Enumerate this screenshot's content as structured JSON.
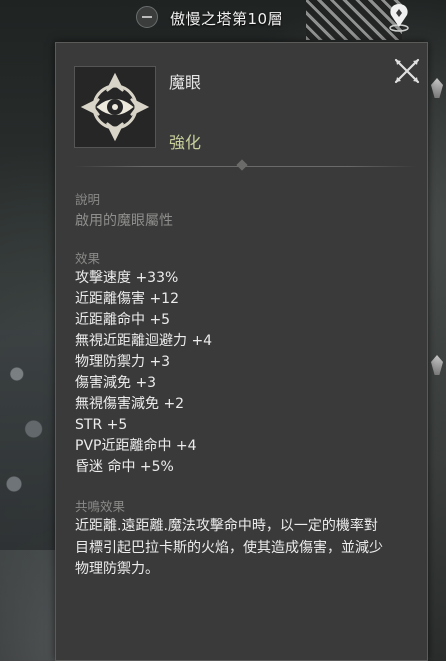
{
  "location": {
    "title": "傲慢之塔第10層"
  },
  "icons": {
    "collapse": "minus-circle-icon",
    "map_pin": "map-pin-icon",
    "item": "magic-eye-icon",
    "close": "close-x-icon"
  },
  "item": {
    "name": "魔眼",
    "grade": "強化"
  },
  "description": {
    "label": "說明",
    "text": "啟用的魔眼屬性"
  },
  "effects": {
    "label": "效果",
    "items": [
      "攻擊速度 +33%",
      "近距離傷害 +12",
      "近距離命中 +5",
      "無視近距離迴避力 +4",
      "物理防禦力 +3",
      "傷害減免 +3",
      "無視傷害減免 +2",
      "STR +5",
      "PVP近距離命中 +4",
      "昏迷 命中 +5%"
    ]
  },
  "resonance": {
    "label": "共鳴效果",
    "lines": [
      "近距離.遠距離.魔法攻擊命中時，以一定的機率對",
      "目標引起巴拉卡斯的火焰，使其造成傷害，並減少",
      "物理防禦力。"
    ]
  },
  "colors": {
    "panel_bg": "#3a3a3a",
    "grade": "#c9cf9c",
    "text": "#ececec",
    "label": "#8a8a88"
  }
}
